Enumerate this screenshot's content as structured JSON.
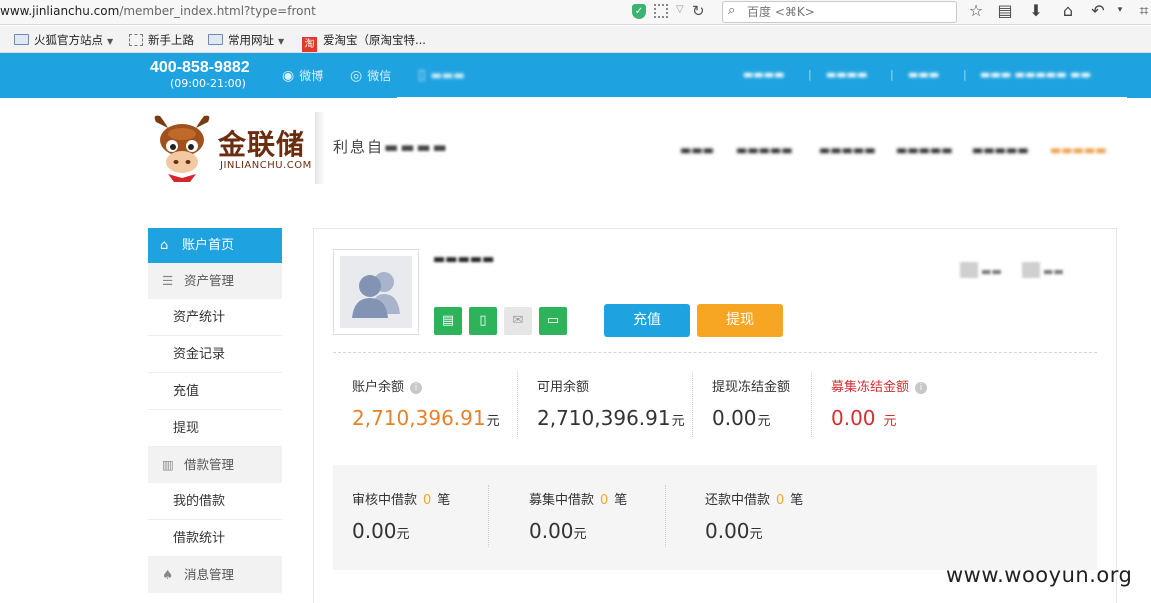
{
  "browser": {
    "url_host": "www.jinlianchu.com",
    "url_path": "/member_index.html?type=front",
    "search_placeholder": "百度 <⌘K>"
  },
  "bookmarks": [
    {
      "label": "火狐官方站点",
      "icon": "folder-icon"
    },
    {
      "label": "新手上路",
      "icon": "page-icon"
    },
    {
      "label": "常用网址",
      "icon": "folder-icon"
    },
    {
      "label": "爱淘宝（原淘宝特...",
      "icon": "taobao-icon"
    }
  ],
  "topbar": {
    "phone": "400-858-9882",
    "hours": "(09:00-21:00)",
    "weibo": "微博",
    "wechat": "微信"
  },
  "logo": {
    "cn": "金联储",
    "en": "JINLIANCHU.COM",
    "slogan_visible": "利息自"
  },
  "sidebar": {
    "home": "账户首页",
    "groups": [
      {
        "label": "资产管理",
        "icon": "database-icon",
        "items": [
          "资产统计",
          "资金记录",
          "充值",
          "提现"
        ]
      },
      {
        "label": "借款管理",
        "icon": "book-icon",
        "items": [
          "我的借款",
          "借款统计"
        ]
      },
      {
        "label": "消息管理",
        "icon": "bell-icon",
        "items": []
      }
    ]
  },
  "account": {
    "recharge_label": "充值",
    "withdraw_label": "提现",
    "stats": [
      {
        "label": "账户余额",
        "value": "2,710,396.91",
        "unit": "元"
      },
      {
        "label": "可用余额",
        "value": "2,710,396.91",
        "unit": "元"
      },
      {
        "label": "提现冻结金额",
        "value": "0.00",
        "unit": "元"
      },
      {
        "label": "募集冻结金额",
        "value": "0.00",
        "unit": "元"
      }
    ],
    "loans": [
      {
        "label": "审核中借款",
        "count": "0",
        "suffix": "笔",
        "value": "0.00",
        "unit": "元"
      },
      {
        "label": "募集中借款",
        "count": "0",
        "suffix": "笔",
        "value": "0.00",
        "unit": "元"
      },
      {
        "label": "还款中借款",
        "count": "0",
        "suffix": "笔",
        "value": "0.00",
        "unit": "元"
      }
    ]
  },
  "watermark": "www.wooyun.org",
  "colors": {
    "brand_blue": "#1fa3e0",
    "orange": "#f7a623",
    "red": "#d32f2f",
    "green": "#2db35a"
  }
}
